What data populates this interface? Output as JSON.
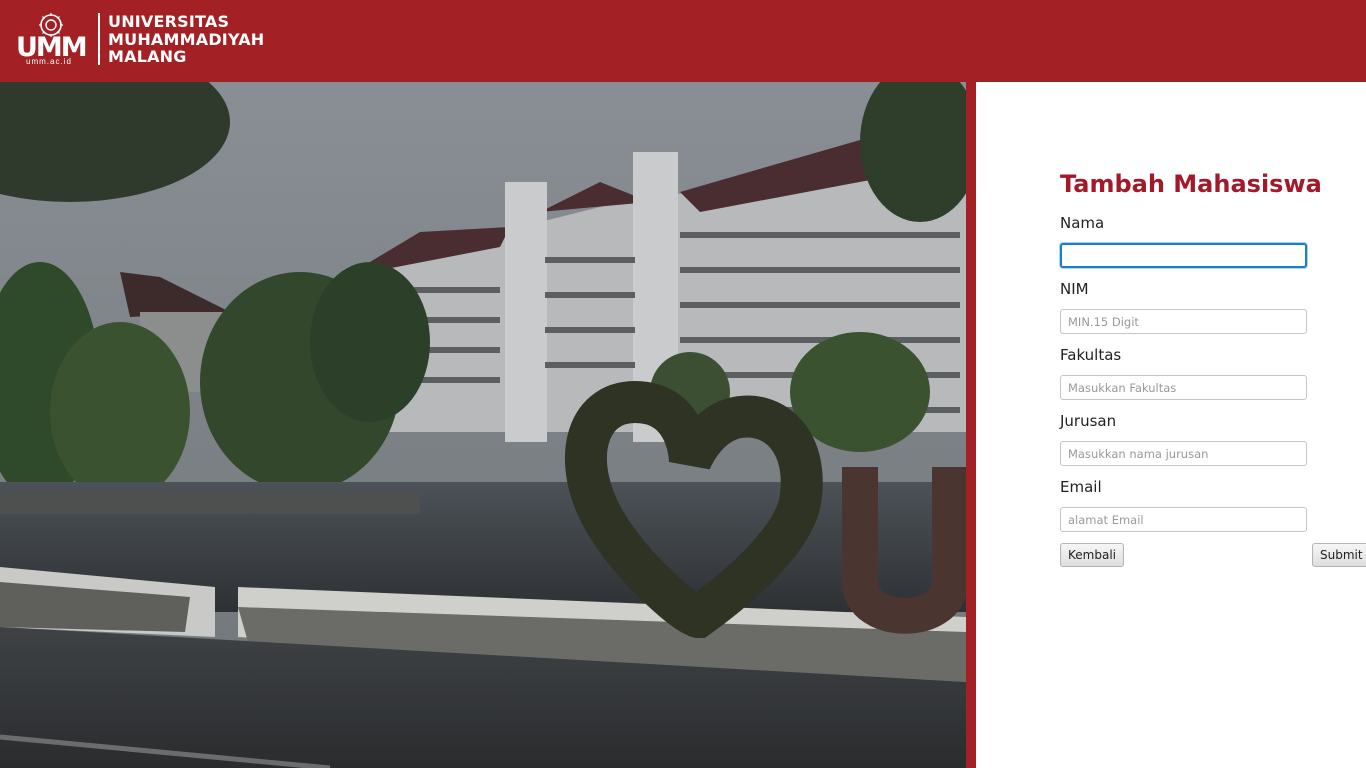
{
  "header": {
    "logo_letters": "UMM",
    "logo_domain": "umm.ac.id",
    "university_lines": [
      "UNIVERSITAS",
      "MUHAMMADIYAH",
      "MALANG"
    ]
  },
  "form": {
    "title": "Tambah Mahasiswa",
    "fields": [
      {
        "label": "Nama",
        "value": "",
        "placeholder": ""
      },
      {
        "label": "NIM",
        "value": "",
        "placeholder": "MIN.15 Digit"
      },
      {
        "label": "Fakultas",
        "value": "",
        "placeholder": "Masukkan Fakultas"
      },
      {
        "label": "Jurusan",
        "value": "",
        "placeholder": "Masukkan nama jurusan"
      },
      {
        "label": "Email",
        "value": "",
        "placeholder": "alamat Email"
      }
    ],
    "back_label": "Kembali",
    "submit_label": "Submit"
  },
  "photo": {
    "subject": "campus-building-photo"
  },
  "colors": {
    "brand_red": "#a32124",
    "title_red": "#a3192a",
    "focus_blue": "#1b7fc8"
  }
}
